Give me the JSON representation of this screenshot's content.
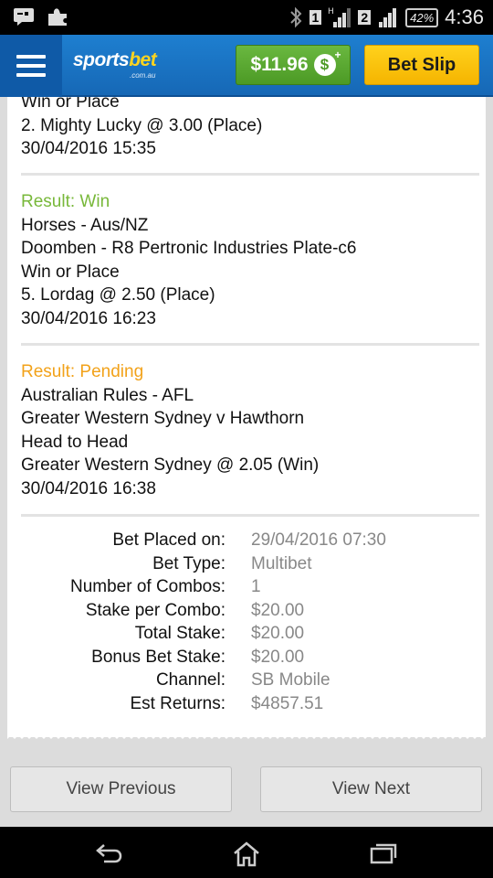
{
  "status_bar": {
    "sim1": "1",
    "sim2": "2",
    "network_h": "H",
    "battery": "42%",
    "time": "4:36"
  },
  "header": {
    "logo_main": "sports",
    "logo_accent": "bet",
    "logo_sub": ".com.au",
    "balance": "$11.96",
    "balance_icon_symbol": "$",
    "bet_slip_label": "Bet Slip",
    "colors": {
      "bar": "#1e7fd0",
      "balance": "#5aaa31",
      "bet_slip": "#ffc60b"
    }
  },
  "legs": [
    {
      "lines": [
        "Win or Place",
        "2. Mighty Lucky @ 3.00 (Place)",
        "30/04/2016 15:35"
      ]
    },
    {
      "result": "Result: Win",
      "lines": [
        "Horses - Aus/NZ",
        "Doomben - R8 Pertronic Industries Plate-c6",
        "Win or Place",
        "5. Lordag @ 2.50 (Place)",
        "30/04/2016 16:23"
      ]
    },
    {
      "result": "Result: Pending",
      "lines": [
        "Australian Rules - AFL",
        "Greater Western Sydney v Hawthorn",
        "Head to Head",
        "Greater Western Sydney @ 2.05 (Win)",
        "30/04/2016 16:38"
      ]
    }
  ],
  "summary": [
    {
      "label": "Bet Placed on:",
      "value": "29/04/2016 07:30"
    },
    {
      "label": "Bet Type:",
      "value": "Multibet"
    },
    {
      "label": "Number of Combos:",
      "value": "1"
    },
    {
      "label": "Stake per Combo:",
      "value": "$20.00"
    },
    {
      "label": "Total Stake:",
      "value": "$20.00"
    },
    {
      "label": "Bonus Bet Stake:",
      "value": "$20.00"
    },
    {
      "label": "Channel:",
      "value": "SB Mobile"
    },
    {
      "label": "Est Returns:",
      "value": "$4857.51"
    }
  ],
  "buttons": {
    "view_previous": "View Previous",
    "view_next": "View Next"
  },
  "result_colors": {
    "win": "#78b83a",
    "pending": "#f2a21a"
  }
}
